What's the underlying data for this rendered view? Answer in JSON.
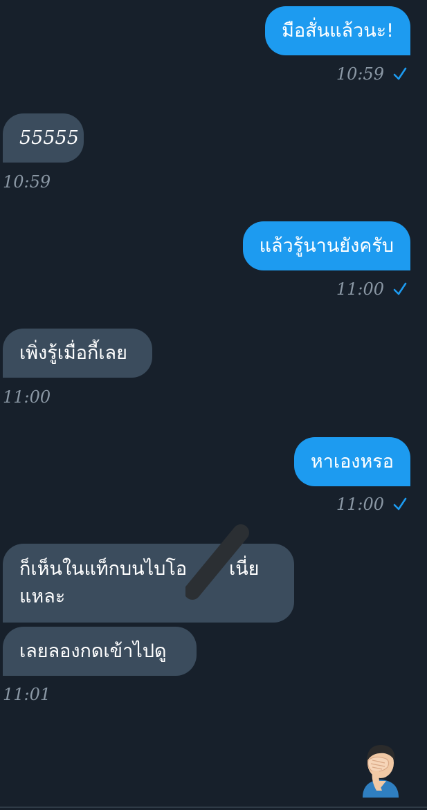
{
  "messages": [
    {
      "side": "out",
      "text": "มือสั่นแล้วนะ!",
      "time": "10:59",
      "read_icon": "check-icon"
    },
    {
      "side": "in",
      "text": "55555",
      "time": "10:59"
    },
    {
      "side": "out",
      "text": "แล้วรู้นานยังครับ",
      "time": "11:00",
      "read_icon": "check-icon"
    },
    {
      "side": "in",
      "text": "เพิ่งรู้เมื่อกี้เลย",
      "time": "11:00"
    },
    {
      "side": "out",
      "text": "หาเองหรอ",
      "time": "11:00",
      "read_icon": "check-icon"
    },
    {
      "side": "in",
      "text_line1": "ก็เห็นในแท็กบนไบโอ",
      "text_line1_end": "เนี่ย",
      "text_line2": "แหละ"
    },
    {
      "side": "in",
      "text": "เลยลองกดเข้าไปดู",
      "time": "11:01"
    }
  ],
  "reaction_emoji": "facepalm-emoji",
  "colors": {
    "background": "#17202b",
    "outgoing_bubble": "#1d9bf0",
    "incoming_bubble": "#3b4c5d",
    "timestamp": "#8b98a5",
    "check": "#1d9bf0"
  }
}
